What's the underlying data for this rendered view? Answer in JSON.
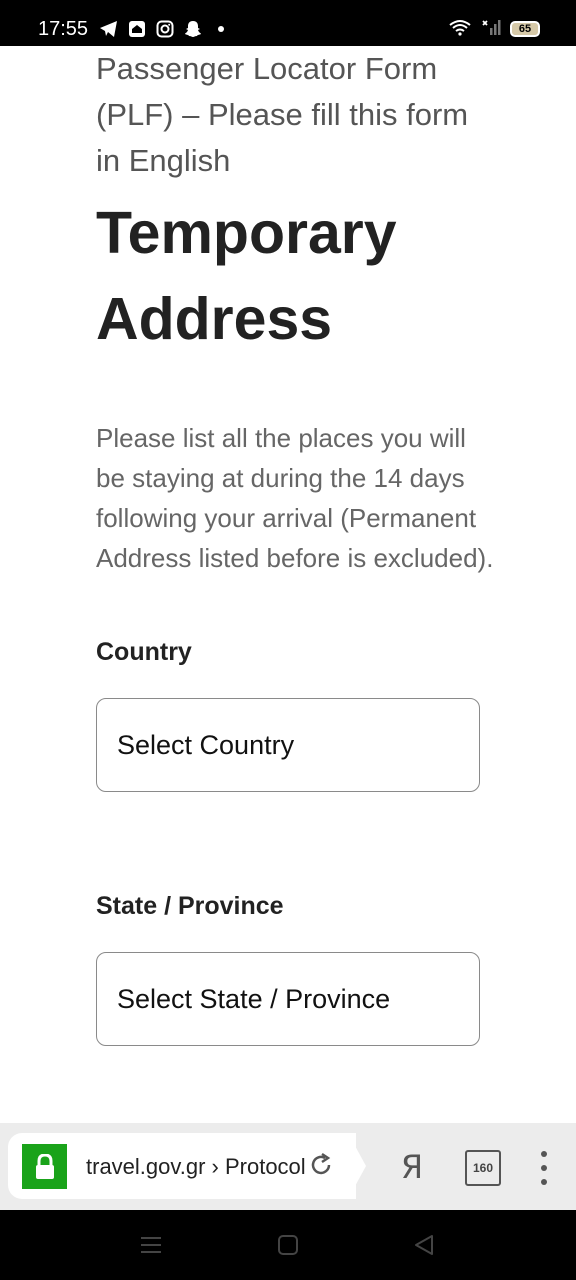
{
  "status_bar": {
    "time": "17:55",
    "left_icons": [
      "telegram-icon",
      "home-app-icon",
      "instagram-icon",
      "snapchat-icon",
      "dot-icon"
    ],
    "right_icons": [
      "wifi-icon",
      "signal-icon",
      "battery-icon"
    ],
    "battery_level": "65"
  },
  "page": {
    "form_header": "Passenger Locator Form (PLF) – Please fill this form in English",
    "section_title": "Temporary Address",
    "description": "Please list all the places you will be staying at during the 14 days following your arrival (Permanent Address listed before is excluded).",
    "fields": [
      {
        "label": "Country",
        "value": "Select Country"
      },
      {
        "label": "State / Province",
        "value": "Select State / Province"
      }
    ]
  },
  "browser": {
    "url": "travel.gov.gr › Protocol",
    "tab_count": "160",
    "search_engine_glyph": "Я",
    "accent_color": "#1aa31a"
  }
}
